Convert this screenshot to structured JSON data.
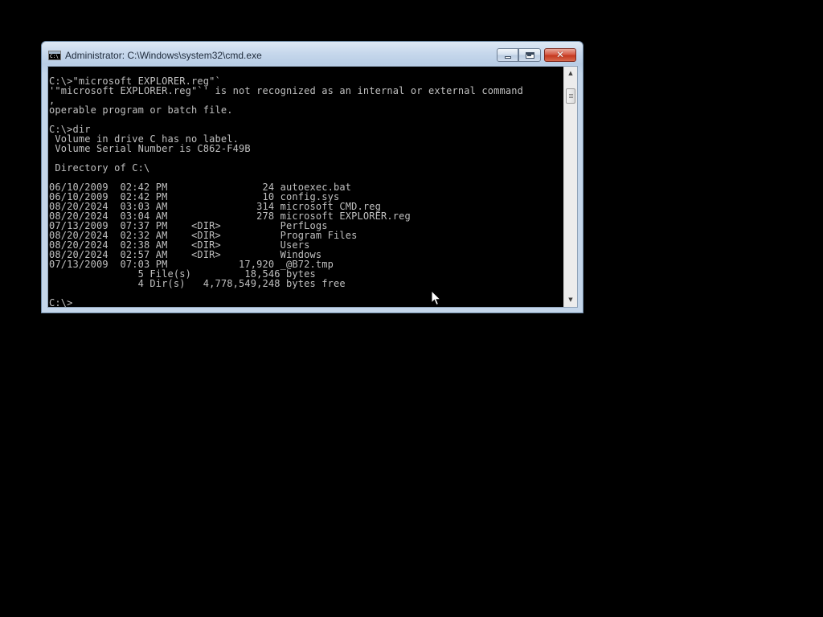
{
  "window": {
    "title": "Administrator: C:\\Windows\\system32\\cmd.exe",
    "icon_glyph": "C:\\",
    "buttons": {
      "minimize": "minimize",
      "maximize": "maximize",
      "close": "✕"
    }
  },
  "console": {
    "lines": [
      "C:\\>\"microsoft EXPLORER.reg\"`",
      "'\"microsoft EXPLORER.reg\"`' is not recognized as an internal or external command",
      ",",
      "operable program or batch file.",
      "",
      "C:\\>dir",
      " Volume in drive C has no label.",
      " Volume Serial Number is C862-F49B",
      "",
      " Directory of C:\\",
      "",
      "06/10/2009  02:42 PM                24 autoexec.bat",
      "06/10/2009  02:42 PM                10 config.sys",
      "08/20/2024  03:03 AM               314 microsoft CMD.reg",
      "08/20/2024  03:04 AM               278 microsoft EXPLORER.reg",
      "07/13/2009  07:37 PM    <DIR>          PerfLogs",
      "08/20/2024  02:32 AM    <DIR>          Program Files",
      "08/20/2024  02:38 AM    <DIR>          Users",
      "08/20/2024  02:57 AM    <DIR>          Windows",
      "07/13/2009  07:03 PM            17,920 _@B72.tmp",
      "               5 File(s)         18,546 bytes",
      "               4 Dir(s)   4,778,549,248 bytes free",
      "",
      "C:\\>"
    ]
  },
  "scrollbar": {
    "up_arrow": "▲",
    "down_arrow": "▼"
  },
  "colors": {
    "desktop_bg": "#000000",
    "console_bg": "#000000",
    "console_text": "#c0c0c0",
    "close_button": "#c4381f",
    "frame": "#c4d6ea"
  }
}
